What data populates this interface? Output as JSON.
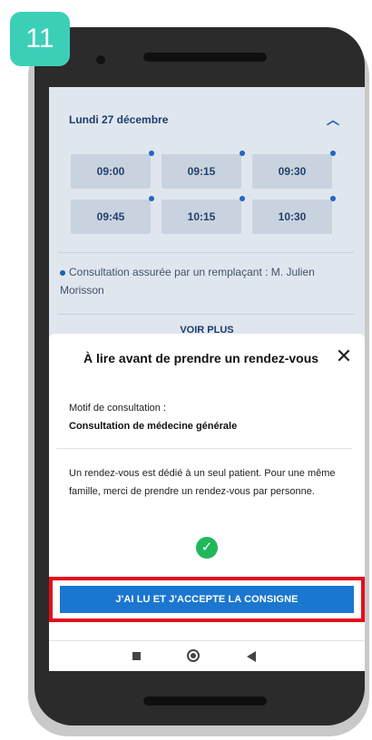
{
  "step_badge": "11",
  "schedule": {
    "date": "Lundi 27 décembre",
    "slots": [
      "09:00",
      "09:15",
      "09:30",
      "09:45",
      "10:15",
      "10:30"
    ],
    "replacement_note": "Consultation assurée par un remplaçant : M. Julien Morisson",
    "more_label": "VOIR PLUS"
  },
  "modal": {
    "title": "À lire avant de prendre un rendez-vous",
    "close_icon": "close-icon",
    "motif_label": "Motif de consultation :",
    "motif_value": "Consultation de médecine générale",
    "notice": "Un rendez-vous est dédié à un seul patient. Pour une même famille, merci de prendre un rendez-vous par personne.",
    "check_icon": "check-circle-icon",
    "accept_button": "J'AI LU ET J'ACCEPTE LA CONSIGNE"
  },
  "colors": {
    "badge": "#3ccfb8",
    "accent": "#1b76cf",
    "highlight": "#e30e1c",
    "success": "#1fb85a"
  }
}
